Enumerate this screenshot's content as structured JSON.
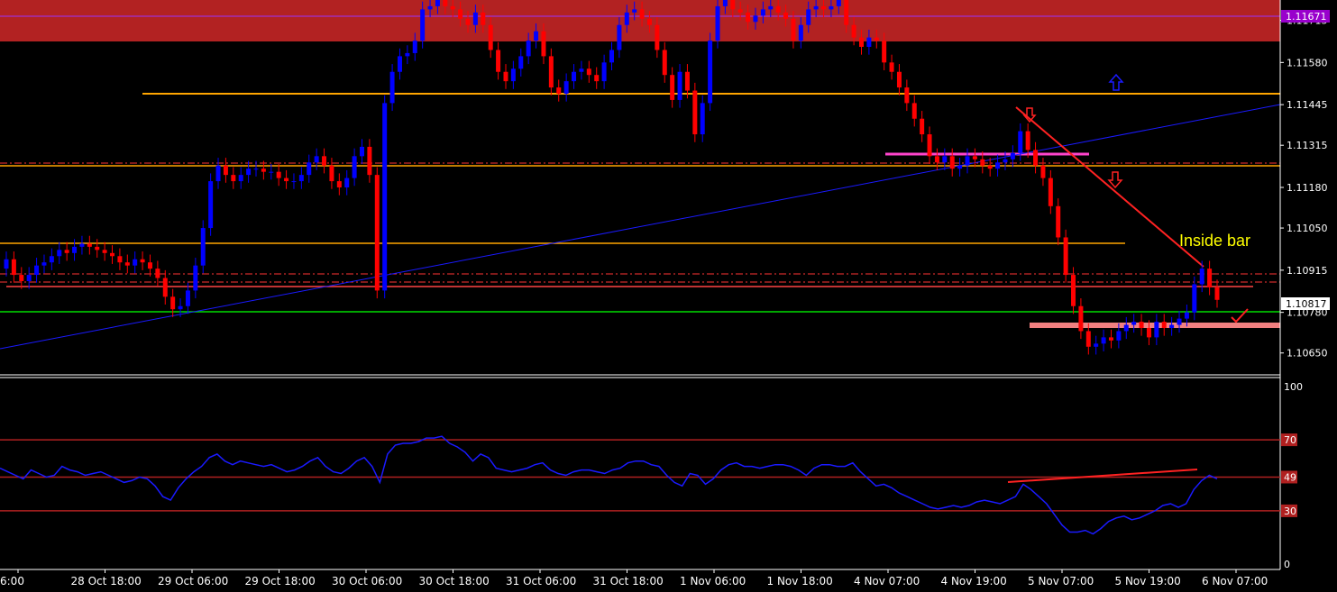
{
  "colors": {
    "background": "#000000",
    "bull": "#0000ff",
    "bear": "#ff0000",
    "zone": "#b22222",
    "orange": "#ffa500",
    "green": "#00ff00",
    "pink": "#f08080",
    "magenta": "#ff44cc",
    "rsi": "#1a1aff",
    "level": "#b02020",
    "price_tag_bid": "#9900cc"
  },
  "chart_data": [
    {
      "type": "line",
      "name": "price",
      "ylim": [
        1.1058,
        1.1178
      ],
      "y_ticks": [
        "1.11715",
        "1.11580",
        "1.11445",
        "1.11315",
        "1.11180",
        "1.11050",
        "1.10915",
        "1.10780",
        "1.10650"
      ],
      "price_tags": {
        "bid": "1.11671",
        "current": "1.10817"
      },
      "x_labels": [
        "6:00",
        "28 Oct 18:00",
        "29 Oct 06:00",
        "29 Oct 18:00",
        "30 Oct 06:00",
        "30 Oct 18:00",
        "31 Oct 06:00",
        "31 Oct 18:00",
        "1 Nov 06:00",
        "1 Nov 18:00",
        "4 Nov 07:00",
        "4 Nov 19:00",
        "5 Nov 07:00",
        "5 Nov 19:00",
        "6 Nov 07:00"
      ],
      "close": [
        1.1095,
        1.109,
        1.1088,
        1.109,
        1.1093,
        1.1094,
        1.1096,
        1.1098,
        1.1097,
        1.1099,
        1.11,
        1.1099,
        1.1098,
        1.1097,
        1.1096,
        1.1094,
        1.1093,
        1.1095,
        1.1094,
        1.1092,
        1.1089,
        1.1083,
        1.1079,
        1.108,
        1.1085,
        1.1093,
        1.1105,
        1.112,
        1.1125,
        1.1122,
        1.112,
        1.1122,
        1.1124,
        1.1124,
        1.1123,
        1.1123,
        1.1121,
        1.112,
        1.112,
        1.1122,
        1.1126,
        1.1128,
        1.1125,
        1.112,
        1.1118,
        1.1121,
        1.1128,
        1.1131,
        1.1122,
        1.1085,
        1.1145,
        1.1155,
        1.116,
        1.1161,
        1.1165,
        1.1175,
        1.1176,
        1.1178,
        1.1176,
        1.1175,
        1.1172,
        1.117,
        1.1174,
        1.117,
        1.1162,
        1.1155,
        1.1152,
        1.1156,
        1.116,
        1.1165,
        1.1168,
        1.116,
        1.115,
        1.1148,
        1.1152,
        1.1155,
        1.1156,
        1.1154,
        1.1152,
        1.1158,
        1.1162,
        1.117,
        1.1174,
        1.1175,
        1.1172,
        1.117,
        1.1162,
        1.1154,
        1.1146,
        1.1155,
        1.1149,
        1.1135,
        1.1145,
        1.1165,
        1.1176,
        1.1178,
        1.1175,
        1.1174,
        1.1171,
        1.1173,
        1.1175,
        1.1176,
        1.1174,
        1.1172,
        1.1165,
        1.117,
        1.1175,
        1.1176,
        1.1175,
        1.1176,
        1.1178,
        1.117,
        1.1166,
        1.1163,
        1.1166,
        1.1165,
        1.1158,
        1.1155,
        1.115,
        1.1145,
        1.114,
        1.1135,
        1.1128,
        1.1126,
        1.1128,
        1.1124,
        1.1125,
        1.1128,
        1.1127,
        1.1125,
        1.1124,
        1.1126,
        1.1127,
        1.1129,
        1.1136,
        1.113,
        1.1125,
        1.1121,
        1.1112,
        1.1102,
        1.109,
        1.108,
        1.1072,
        1.1067,
        1.1068,
        1.107,
        1.1069,
        1.1072,
        1.1074,
        1.1075,
        1.1073,
        1.107,
        1.1075,
        1.1073,
        1.1074,
        1.1076,
        1.1078,
        1.1087,
        1.1092,
        1.1086,
        1.1082
      ]
    },
    {
      "type": "line",
      "name": "RSI",
      "ylim": [
        0,
        100
      ],
      "y_ticks": [
        "100",
        "70",
        "49",
        "30",
        "0"
      ],
      "levels": [
        70,
        49,
        30
      ],
      "values": [
        54,
        52,
        50,
        48,
        53,
        51,
        49,
        50,
        55,
        53,
        52,
        50,
        51,
        52,
        50,
        48,
        46,
        47,
        49,
        48,
        44,
        38,
        36,
        43,
        48,
        52,
        55,
        60,
        62,
        58,
        56,
        58,
        57,
        56,
        55,
        56,
        54,
        52,
        53,
        55,
        58,
        60,
        55,
        52,
        51,
        54,
        58,
        60,
        55,
        46,
        62,
        67,
        68,
        68,
        69,
        71,
        71,
        72,
        68,
        66,
        63,
        58,
        62,
        60,
        54,
        53,
        52,
        53,
        54,
        56,
        57,
        53,
        51,
        50,
        52,
        53,
        53,
        52,
        51,
        53,
        54,
        57,
        58,
        58,
        56,
        55,
        50,
        46,
        44,
        51,
        50,
        45,
        48,
        53,
        56,
        57,
        55,
        55,
        54,
        55,
        56,
        56,
        55,
        53,
        50,
        54,
        56,
        56,
        55,
        55,
        57,
        52,
        48,
        44,
        45,
        43,
        40,
        38,
        36,
        34,
        32,
        31,
        32,
        33,
        32,
        33,
        35,
        36,
        35,
        34,
        36,
        38,
        45,
        42,
        38,
        34,
        28,
        22,
        18,
        18,
        19,
        17,
        20,
        24,
        26,
        27,
        25,
        26,
        28,
        30,
        33,
        34,
        32,
        34,
        42,
        47,
        50,
        48
      ]
    }
  ],
  "annotations": {
    "inside_bar": "Inside bar"
  }
}
